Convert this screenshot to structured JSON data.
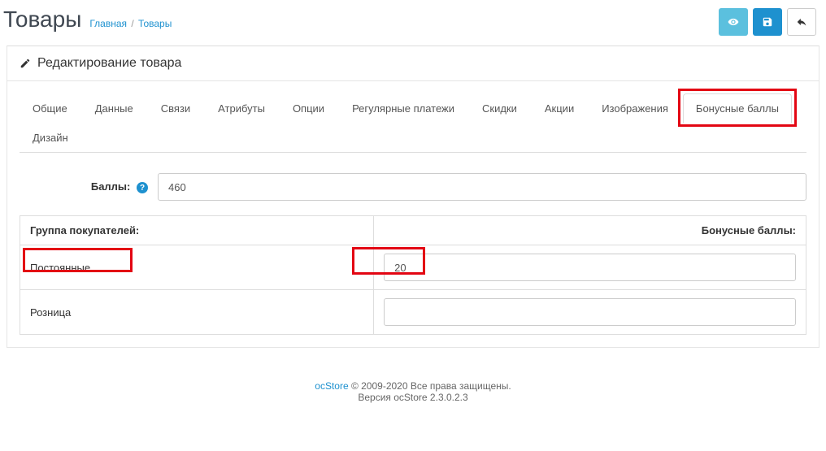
{
  "header": {
    "title": "Товары",
    "breadcrumb_home": "Главная",
    "breadcrumb_sep": "/",
    "breadcrumb_current": "Товары"
  },
  "panel": {
    "title": "Редактирование товара"
  },
  "tabs": {
    "general": "Общие",
    "data": "Данные",
    "links": "Связи",
    "attribute": "Атрибуты",
    "option": "Опции",
    "recurring": "Регулярные платежи",
    "discount": "Скидки",
    "special": "Акции",
    "image": "Изображения",
    "reward": "Бонусные баллы",
    "design": "Дизайн"
  },
  "reward": {
    "points_label": "Баллы:",
    "points_value": "460",
    "table_header_group": "Группа покупателей:",
    "table_header_points": "Бонусные баллы:",
    "rows": [
      {
        "group": "Постоянные",
        "value": "20"
      },
      {
        "group": "Розница",
        "value": ""
      }
    ]
  },
  "footer": {
    "link": "ocStore",
    "copyright": " © 2009-2020 Все права защищены.",
    "version": "Версия ocStore 2.3.0.2.3"
  }
}
